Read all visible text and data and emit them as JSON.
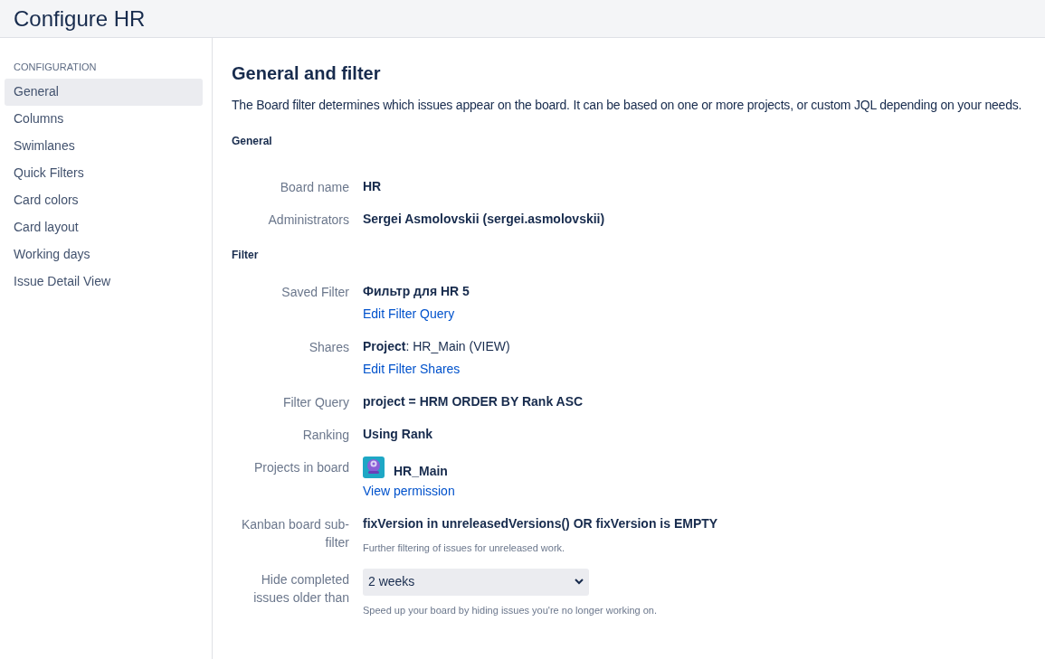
{
  "header": {
    "title": "Configure HR"
  },
  "sidebar": {
    "heading": "CONFIGURATION",
    "items": [
      {
        "label": "General",
        "selected": true
      },
      {
        "label": "Columns",
        "selected": false
      },
      {
        "label": "Swimlanes",
        "selected": false
      },
      {
        "label": "Quick Filters",
        "selected": false
      },
      {
        "label": "Card colors",
        "selected": false
      },
      {
        "label": "Card layout",
        "selected": false
      },
      {
        "label": "Working days",
        "selected": false
      },
      {
        "label": "Issue Detail View",
        "selected": false
      }
    ]
  },
  "main": {
    "title": "General and filter",
    "description": "The Board filter determines which issues appear on the board. It can be based on one or more projects, or custom JQL depending on your needs.",
    "sections": [
      {
        "heading": "General",
        "rows": [
          {
            "kind": "text",
            "label": "Board name",
            "value": "HR"
          },
          {
            "kind": "text",
            "label": "Administrators",
            "value": "Sergei Asmolovskii (sergei.asmolovskii)"
          }
        ]
      },
      {
        "heading": "Filter",
        "rows": [
          {
            "kind": "text",
            "label": "Saved Filter",
            "value": "Фильтр для HR 5",
            "link": "Edit Filter Query"
          },
          {
            "kind": "rich",
            "label": "Shares",
            "value": "**Project**: HR_Main (VIEW)",
            "link": "Edit Filter Shares"
          },
          {
            "kind": "text",
            "label": "Filter Query",
            "value": "project = HRM ORDER BY Rank ASC"
          },
          {
            "kind": "text",
            "label": "Ranking",
            "value": "Using Rank"
          },
          {
            "kind": "project",
            "label": "Projects in board",
            "value": "HR_Main",
            "link": "View permission"
          },
          {
            "kind": "text",
            "label": "Kanban board sub-filter",
            "value": "fixVersion in unreleasedVersions() OR fixVersion is EMPTY",
            "help": "Further filtering of issues for unreleased work."
          },
          {
            "kind": "select",
            "label": "Hide completed issues older than",
            "value": "2 weeks",
            "help": "Speed up your board by hiding issues you're no longer working on."
          }
        ]
      }
    ]
  }
}
